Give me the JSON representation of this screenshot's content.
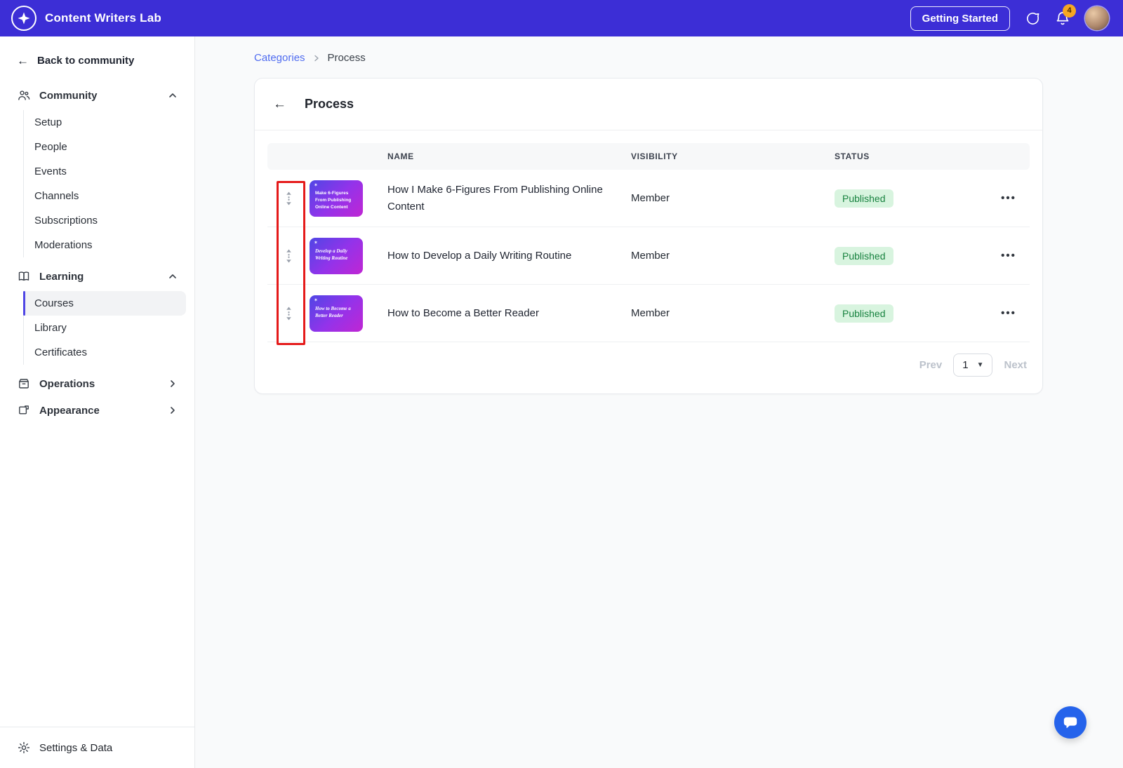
{
  "topbar": {
    "brand": "Content Writers Lab",
    "getting_started": "Getting Started",
    "notification_count": "4"
  },
  "breadcrumb": {
    "category": "Categories",
    "current": "Process"
  },
  "page": {
    "title": "Process"
  },
  "sidebar": {
    "back_link": "Back to community",
    "community": {
      "label": "Community",
      "items": [
        "Setup",
        "People",
        "Events",
        "Channels",
        "Subscriptions",
        "Moderations"
      ]
    },
    "learning": {
      "label": "Learning",
      "items": [
        "Courses",
        "Library",
        "Certificates"
      ],
      "active_item": "Courses"
    },
    "operations_label": "Operations",
    "appearance_label": "Appearance",
    "settings_label": "Settings & Data"
  },
  "table": {
    "headers": {
      "name": "NAME",
      "visibility": "VISIBILITY",
      "status": "STATUS"
    },
    "rows": [
      {
        "thumb_title": "Make 6-Figures From Publishing Online Content",
        "name": "How I Make 6-Figures From Publishing Online Content",
        "visibility": "Member",
        "status": "Published"
      },
      {
        "thumb_title": "Develop a Daily Writing Routine",
        "name": "How to Develop a Daily Writing Routine",
        "visibility": "Member",
        "status": "Published"
      },
      {
        "thumb_title": "How to Become a Better Reader",
        "name": "How to Become a Better Reader",
        "visibility": "Member",
        "status": "Published"
      }
    ]
  },
  "pagination": {
    "prev": "Prev",
    "page": "1",
    "next": "Next"
  },
  "colors": {
    "topbar": "#3C2ED6",
    "link": "#506CF0",
    "active_accent": "#4F46E5",
    "status_badge_bg": "#D8F4DF",
    "status_badge_text": "#17823F",
    "annotation_red": "#E51A1A",
    "chat_widget_blue": "#2563EB",
    "notification_badge": "#F6A723"
  }
}
